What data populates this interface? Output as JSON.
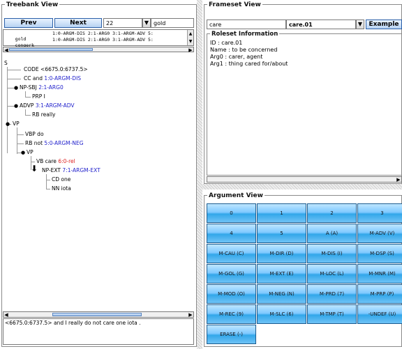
{
  "treebank": {
    "title": "Treebank View",
    "prev_label": "Prev",
    "next_label": "Next",
    "index_value": "22",
    "source_value": "gold",
    "rows": [
      {
        "name": "gold",
        "text": "1:0-ARGM-DIS 2:1-ARG0 3:1-ARGM-ADV 5:"
      },
      {
        "name": "congerk",
        "text": "1:0-ARGM-DIS 2:1-ARG0 3:1-ARGM-ADV 5:"
      }
    ],
    "tree": {
      "root": "S",
      "n1": "CODE <6675.0:6737.5>",
      "n2_tag": "CC and",
      "n2_arg": "1:0-ARGM-DIS",
      "n3_tag": "NP-SBJ",
      "n3_arg": "2:1-ARG0",
      "n3a": "PRP I",
      "n4_tag": "ADVP",
      "n4_arg": "3:1-ARGM-ADV",
      "n4a": "RB really",
      "n5": "VP",
      "n5a": "VBP do",
      "n5b_tag": "RB not",
      "n5b_arg": "5:0-ARGM-NEG",
      "n5c": "VP",
      "n6_tag": "VB care",
      "n6_arg": "6:0-rel",
      "n7_tag": "NP-EXT",
      "n7_arg": "7:1-ARGM-EXT",
      "n7a": "CD one",
      "n7b": "NN iota"
    },
    "sentence": "<6675.0:6737.5> and I really do not care one iota ."
  },
  "frameset": {
    "title": "Frameset View",
    "lemma_value": "care",
    "roleset_value": "care.01",
    "example_label": "Example",
    "roleset_title": "Roleset Information",
    "info": [
      "ID : care.01",
      "Name : to be concerned",
      "Arg0 : carer, agent",
      "Arg1 : thing cared for/about"
    ]
  },
  "argument": {
    "title": "Argument View",
    "buttons": [
      "0",
      "1",
      "2",
      "3",
      "4",
      "5",
      "A (A)",
      "M-ADV (V)",
      "M-CAU (C)",
      "M-DIR (D)",
      "M-DIS (I)",
      "M-DSP (S)",
      "M-GOL (G)",
      "M-EXT (E)",
      "M-LOC (L)",
      "M-MNR (M)",
      "M-MOD (O)",
      "M-NEG (N)",
      "M-PRD (7)",
      "M-PRP (P)",
      "M-REC (9)",
      "M-SLC (6)",
      "M-TMP (T)",
      "-UNDEF (U)",
      "ERASE (-)"
    ]
  }
}
